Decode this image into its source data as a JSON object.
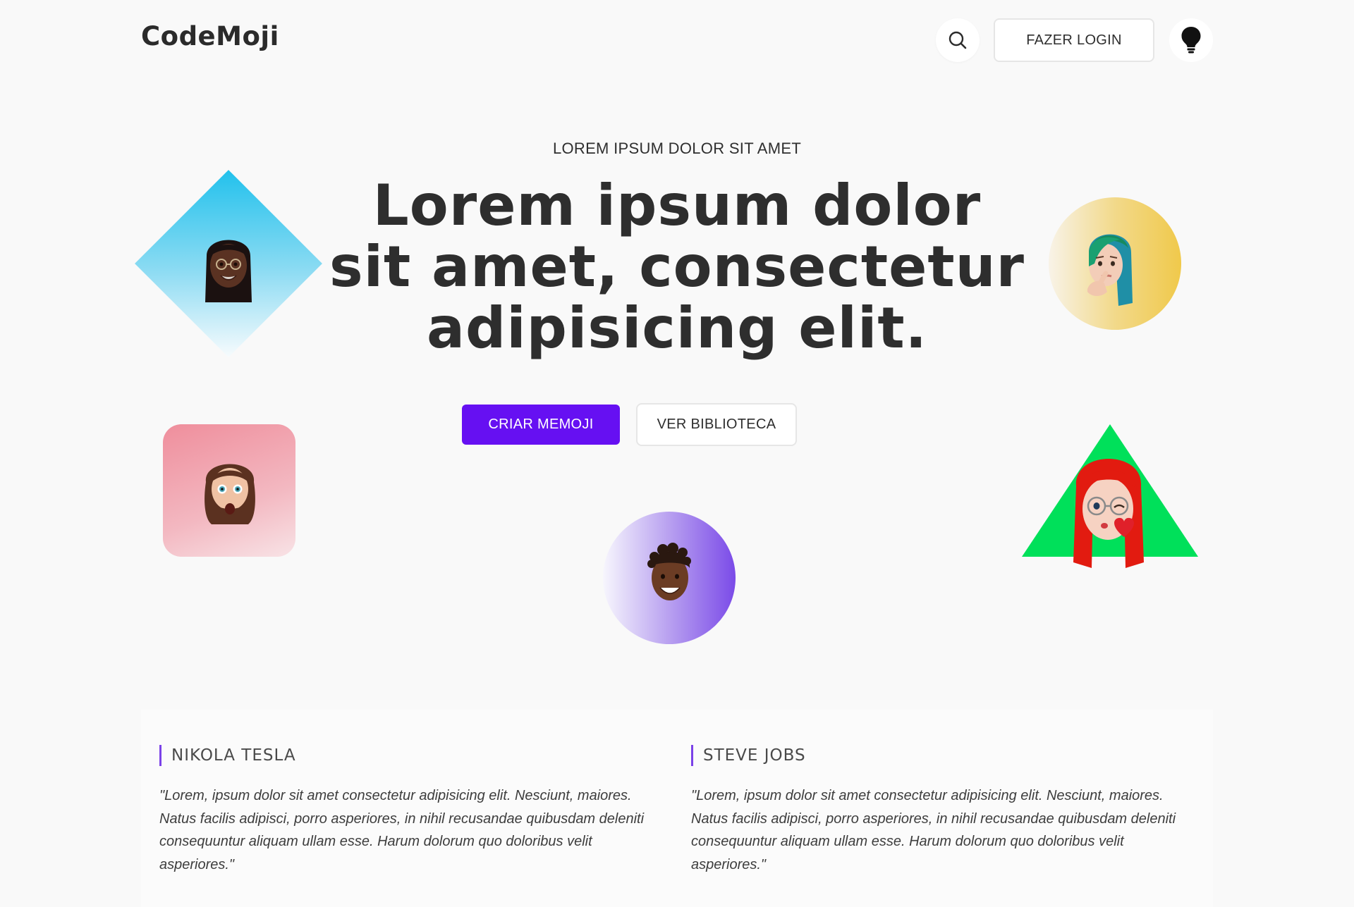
{
  "header": {
    "logo": "CodeMoji",
    "search_icon": "search-icon",
    "login_label": "FAZER LOGIN",
    "theme_icon": "lightbulb-icon"
  },
  "hero": {
    "eyebrow": "LOREM IPSUM DOLOR SIT AMET",
    "title": "Lorem ipsum dolor sit amet, consectetur adipisicing elit.",
    "primary_button": "CRIAR MEMOJI",
    "secondary_button": "VER BIBLIOTECA"
  },
  "avatars": [
    {
      "name": "memoji-woman-black-hair",
      "shape": "diamond",
      "color": "#22c1ec"
    },
    {
      "name": "memoji-woman-green-hair",
      "shape": "circle",
      "color": "#f0c94b"
    },
    {
      "name": "memoji-man-long-hair",
      "shape": "rounded-square",
      "color": "#ef8e9c"
    },
    {
      "name": "memoji-man-curly-hair",
      "shape": "circle",
      "color": "#7b4be8"
    },
    {
      "name": "memoji-woman-red-hair",
      "shape": "triangle",
      "color": "#00e05a"
    }
  ],
  "quotes": [
    {
      "author": "NIKOLA TESLA",
      "text": "\"Lorem, ipsum dolor sit amet consectetur adipisicing elit. Nesciunt, maiores. Natus facilis adipisci, porro asperiores, in nihil recusandae quibusdam deleniti consequuntur aliquam ullam esse. Harum dolorum quo doloribus velit asperiores.\""
    },
    {
      "author": "STEVE JOBS",
      "text": "\"Lorem, ipsum dolor sit amet consectetur adipisicing elit. Nesciunt, maiores. Natus facilis adipisci, porro asperiores, in nihil recusandae quibusdam deleniti consequuntur aliquam ullam esse. Harum dolorum quo doloribus velit asperiores.\""
    }
  ],
  "colors": {
    "accent": "#6610f2",
    "quote_border": "#7b42e8",
    "background": "#f9f9f9",
    "text": "#2e2e2e"
  }
}
